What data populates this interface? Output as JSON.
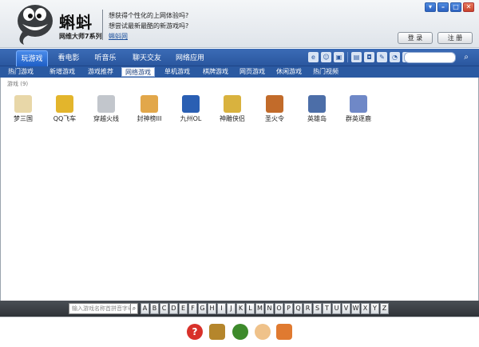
{
  "app": {
    "brand": "蝌蚪",
    "brand_sub": "网维大师7系列",
    "news": [
      "想获得个性化的上网体验吗?",
      "想尝试最新最酷的新游戏吗?"
    ],
    "link": "蝌蚪网",
    "login_label": "登 录",
    "register_label": "注 册",
    "window_buttons": [
      "▾",
      "–",
      "□",
      "✕"
    ]
  },
  "tabs": [
    {
      "label": "玩游戏",
      "active": true
    },
    {
      "label": "看电影"
    },
    {
      "label": "听音乐"
    },
    {
      "label": "聊天交友"
    },
    {
      "label": "网络应用"
    }
  ],
  "toolbar_icons": [
    "ie-icon",
    "penguin-icon",
    "lock-icon",
    "film-icon",
    "camera-icon",
    "pen-icon",
    "chat-icon",
    "note-icon"
  ],
  "search": {
    "placeholder": ""
  },
  "subtabs": [
    {
      "label": "热门游戏"
    },
    {
      "label": "新增游戏"
    },
    {
      "label": "游戏推荐"
    },
    {
      "label": "网络游戏",
      "active": true
    },
    {
      "label": "单机游戏"
    },
    {
      "label": "棋牌游戏"
    },
    {
      "label": "网页游戏"
    },
    {
      "label": "休闲游戏"
    },
    {
      "label": "热门视频"
    }
  ],
  "section": {
    "label": "游戏 (9)"
  },
  "games": [
    {
      "name": "梦三国",
      "color": "#e8d7a8"
    },
    {
      "name": "QQ飞车",
      "color": "#e3b52c"
    },
    {
      "name": "穿越火线",
      "color": "#c2c6cc"
    },
    {
      "name": "封神榜III",
      "color": "#e2a74a"
    },
    {
      "name": "九州OL",
      "color": "#2a5fb3"
    },
    {
      "name": "神雕侠侣",
      "color": "#d9b23e"
    },
    {
      "name": "圣火令",
      "color": "#c26b2a"
    },
    {
      "name": "英雄岛",
      "color": "#4c6ea8"
    },
    {
      "name": "群英逐鹿",
      "color": "#6f88c7"
    }
  ],
  "alpha": {
    "search_placeholder": "输入游戏名称首拼音字母",
    "letters": [
      "A",
      "B",
      "C",
      "D",
      "E",
      "F",
      "G",
      "H",
      "I",
      "J",
      "K",
      "L",
      "M",
      "N",
      "O",
      "P",
      "Q",
      "R",
      "S",
      "T",
      "U",
      "V",
      "W",
      "X",
      "Y",
      "Z"
    ]
  },
  "bottom_icons": [
    {
      "name": "help-icon",
      "color": "#d8312a"
    },
    {
      "name": "game-logo-icon",
      "color": "#b5862c"
    },
    {
      "name": "tiger-icon",
      "color": "#3d8a2b"
    },
    {
      "name": "character-icon",
      "color": "#efc28a"
    },
    {
      "name": "dragon-icon",
      "color": "#e07a30"
    }
  ]
}
